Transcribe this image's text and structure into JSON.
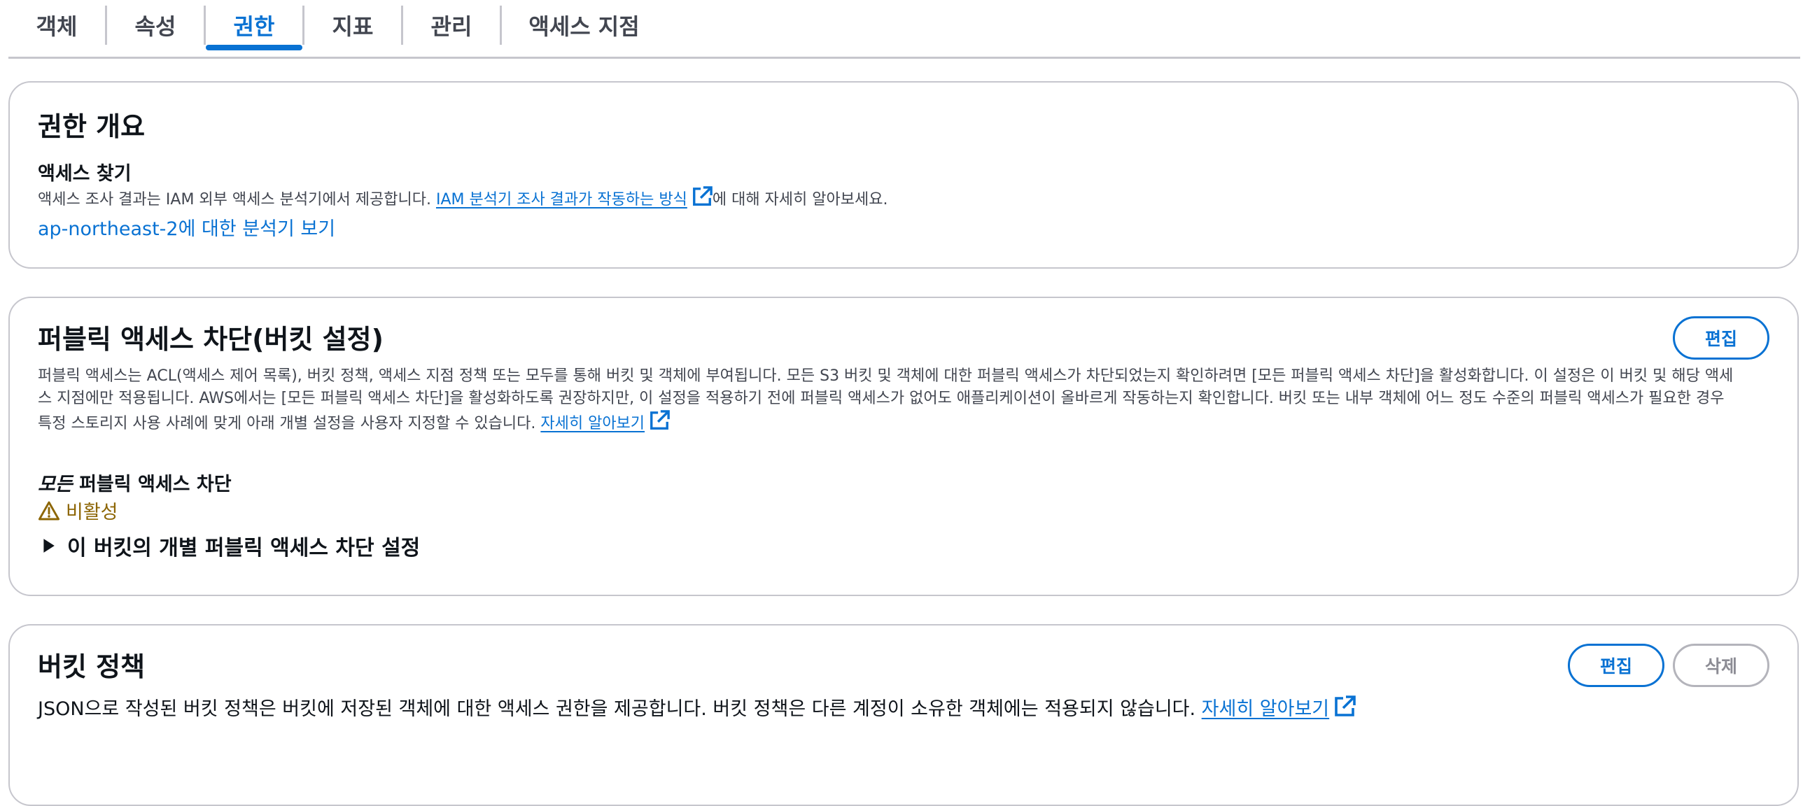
{
  "tabs": [
    {
      "label": "객체",
      "active": false
    },
    {
      "label": "속성",
      "active": false
    },
    {
      "label": "권한",
      "active": true
    },
    {
      "label": "지표",
      "active": false
    },
    {
      "label": "관리",
      "active": false
    },
    {
      "label": "액세스 지점",
      "active": false
    }
  ],
  "overview": {
    "title": "권한 개요",
    "subtitle": "액세스 찾기",
    "desc_prefix": "액세스 조사 결과는 IAM 외부 액세스 분석기에서 제공합니다. ",
    "desc_link": "IAM 분석기 조사 결과가 작동하는 방식",
    "desc_suffix": "에 대해 자세히 알아보세요.",
    "analyzer_link": "ap-northeast-2에 대한 분석기 보기"
  },
  "public_block": {
    "title": "퍼블릭 액세스 차단(버킷 설정)",
    "edit_label": "편집",
    "desc_line1": "퍼블릭 액세스는 ACL(액세스 제어 목록), 버킷 정책, 액세스 지점 정책 또는 모두를 통해 버킷 및 객체에 부여됩니다. 모든 S3 버킷 및 객체에 대한 퍼블릭 액세스가 차단되었는지 확인하려면 [모든 퍼블릭 액세스 차단]을 활성화합니다. 이 설정은 이 버킷 및 해당 액세",
    "desc_line2": "스 지점에만 적용됩니다. AWS에서는 [모든 퍼블릭 액세스 차단]을 활성화하도록 권장하지만, 이 설정을 적용하기 전에 퍼블릭 액세스가 없어도 애플리케이션이 올바르게 작동하는지 확인합니다. 버킷 또는 내부 객체에 어느 정도 수준의 퍼블릭 액세스가 필요한 경우",
    "desc_line3": "특정 스토리지 사용 사례에 맞게 아래 개별 설정을 사용자 지정할 수 있습니다. ",
    "learn_more": "자세히 알아보기",
    "block_all_em": "모든",
    "block_all_rest": " 퍼블릭 액세스 차단",
    "status": "비활성",
    "status_color": "#8d6605",
    "expander_label": "이 버킷의 개별 퍼블릭 액세스 차단 설정"
  },
  "bucket_policy": {
    "title": "버킷 정책",
    "edit_label": "편집",
    "delete_label": "삭제",
    "desc": "JSON으로 작성된 버킷 정책은 버킷에 저장된 객체에 대한 액세스 권한을 제공합니다. 버킷 정책은 다른 계정이 소유한 객체에는 적용되지 않습니다. ",
    "learn_more": "자세히 알아보기"
  },
  "colors": {
    "accent": "#0972d3",
    "border": "#c6c6cd",
    "warning": "#8d6605"
  },
  "icons": [
    "external-link-icon",
    "warning-icon",
    "caret-right-icon"
  ]
}
